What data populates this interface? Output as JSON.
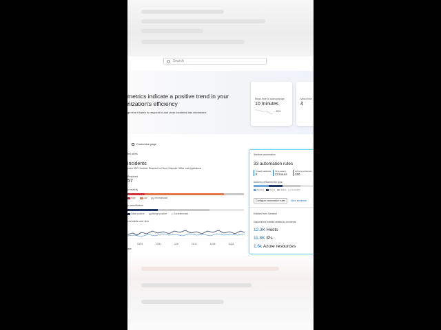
{
  "search": {
    "placeholder": "Search"
  },
  "hero": {
    "title": "metrics indicate a positive trend in your\nnization's efficiency",
    "subtitle": "ge time it takes to respond to and close incidents has decreased."
  },
  "metric_cards": [
    {
      "label": "Mean time to acknowledge",
      "value": "10 minutes",
      "trend": "↓ 85%"
    },
    {
      "label": "Mean time",
      "value": "4",
      "trend": ""
    }
  ],
  "customize": {
    "label": "Customize page"
  },
  "incidents": {
    "header": "ted alerts",
    "title": "incidents",
    "sources": "ender XDR, Sentinel, Defender for Cloud, Endpoint, Office, and Applications",
    "resolved_label": "Resolved",
    "resolved_value": "57",
    "severity_label": "y severity",
    "severity_legend": [
      "High",
      "Low",
      "Informational"
    ],
    "classification_label": "y classification",
    "classification_legend": [
      "False positive",
      "Benign positive",
      "Undetermined"
    ],
    "over_time_label": "ved alerts over time",
    "x_ticks": [
      "10/25",
      "10/31",
      "11/6",
      "11/12",
      "11/18",
      "11/24"
    ],
    "footer": "ays"
  },
  "sentinel": {
    "header": "Sentinel automation",
    "title": "33 automation rules",
    "metrics": [
      {
        "label": "Closed incidents",
        "value": "6"
      },
      {
        "label": "Time saved",
        "value": "23 hours"
      },
      {
        "label": "Actions performed",
        "value": "250"
      }
    ],
    "actions_label": "Actions performed by type",
    "actions_legend": [
      "Severity",
      "Owner",
      "Status",
      "Comment"
    ],
    "configure_button": "Configure automation rules",
    "view_link": "View incidents",
    "entities_header": "Entities from Sentinel",
    "entities_sub": "Discovered entities related to incidents",
    "entities": [
      {
        "value": "12.3K",
        "label": "Hosts"
      },
      {
        "value": "11.8K",
        "label": "IPs"
      },
      {
        "value": "1.6k",
        "label": "Azure resources"
      }
    ]
  },
  "colors": {
    "accent": "#0f6cbd",
    "high": "#d13438",
    "low": "#e0744a",
    "informational": "#c8c8c8",
    "navy": "#1f3864",
    "border_highlight": "#7fd6e6"
  }
}
